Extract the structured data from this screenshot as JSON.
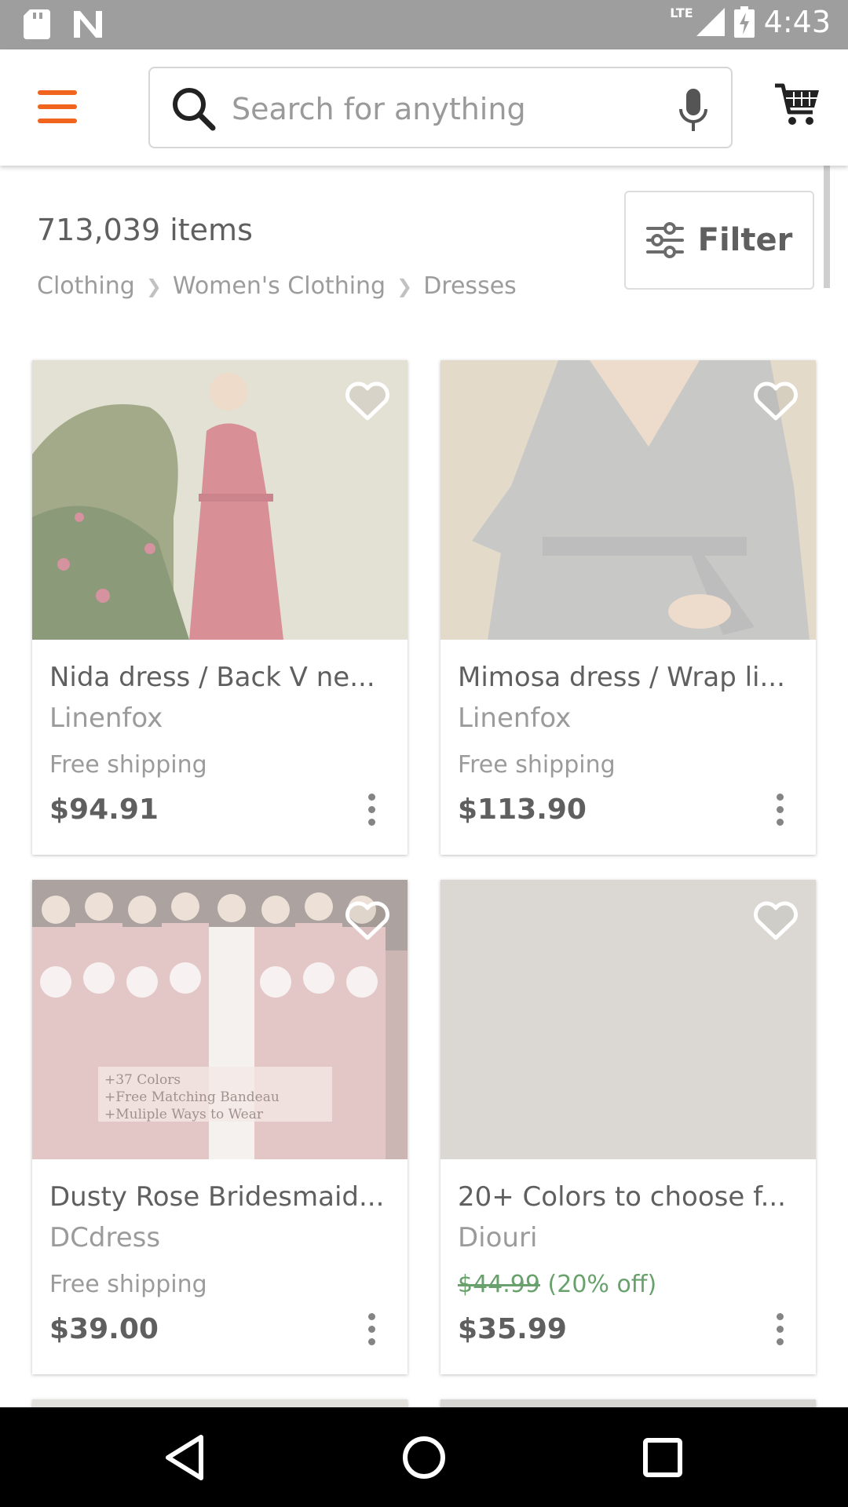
{
  "status_bar": {
    "time": "4:43",
    "network": "LTE"
  },
  "header": {
    "search_placeholder": "Search for anything"
  },
  "results": {
    "count_label": "713,039 items",
    "breadcrumb": [
      "Clothing",
      "Women's Clothing",
      "Dresses"
    ],
    "filter_label": "Filter"
  },
  "listings": [
    {
      "title": "Nida dress / Back V ne...",
      "shop": "Linenfox",
      "shipping": "Free shipping",
      "price": "$94.91"
    },
    {
      "title": "Mimosa dress / Wrap li...",
      "shop": "Linenfox",
      "shipping": "Free shipping",
      "price": "$113.90"
    },
    {
      "title": "Dusty Rose Bridesmaid...",
      "shop": "DCdress",
      "shipping": "Free shipping",
      "price": "$39.00",
      "image_text": [
        "+37 Colors",
        "+Free Matching Bandeau",
        "+Muliple Ways to Wear"
      ]
    },
    {
      "title": "20+ Colors to choose f...",
      "shop": "Diouri",
      "original_price": "$44.99",
      "discount": "(20% off)",
      "price": "$35.99"
    }
  ],
  "colors": {
    "accent": "#f1641e",
    "sale": "#2e7d32"
  }
}
